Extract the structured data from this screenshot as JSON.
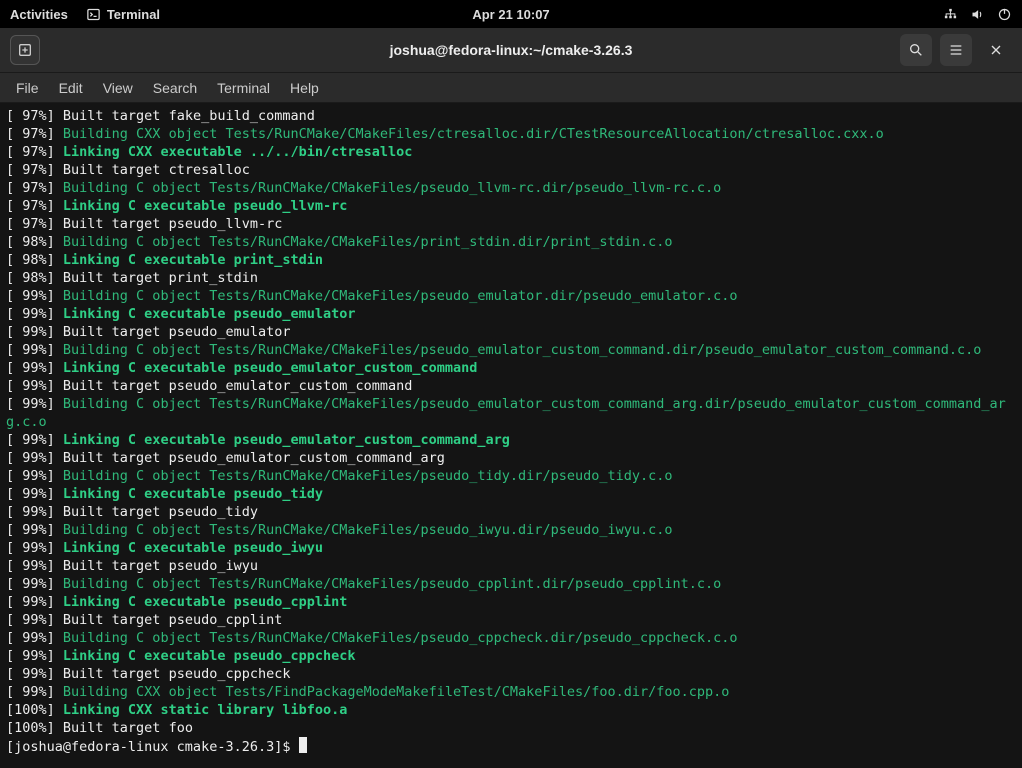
{
  "topbar": {
    "activities": "Activities",
    "app_label": "Terminal",
    "datetime": "Apr 21  10:07"
  },
  "titlebar": {
    "title": "joshua@fedora-linux:~/cmake-3.26.3"
  },
  "menubar": {
    "items": [
      "File",
      "Edit",
      "View",
      "Search",
      "Terminal",
      "Help"
    ]
  },
  "lines": [
    {
      "pct": "97%",
      "style": "plain",
      "text": "Built target fake_build_command"
    },
    {
      "pct": "97%",
      "style": "green",
      "text": "Building CXX object Tests/RunCMake/CMakeFiles/ctresalloc.dir/CTestResourceAllocation/ctresalloc.cxx.o"
    },
    {
      "pct": "97%",
      "style": "brightgreen",
      "text": "Linking CXX executable ../../bin/ctresalloc"
    },
    {
      "pct": "97%",
      "style": "plain",
      "text": "Built target ctresalloc"
    },
    {
      "pct": "97%",
      "style": "green",
      "text": "Building C object Tests/RunCMake/CMakeFiles/pseudo_llvm-rc.dir/pseudo_llvm-rc.c.o"
    },
    {
      "pct": "97%",
      "style": "brightgreen",
      "text": "Linking C executable pseudo_llvm-rc"
    },
    {
      "pct": "97%",
      "style": "plain",
      "text": "Built target pseudo_llvm-rc"
    },
    {
      "pct": "98%",
      "style": "green",
      "text": "Building C object Tests/RunCMake/CMakeFiles/print_stdin.dir/print_stdin.c.o"
    },
    {
      "pct": "98%",
      "style": "brightgreen",
      "text": "Linking C executable print_stdin"
    },
    {
      "pct": "98%",
      "style": "plain",
      "text": "Built target print_stdin"
    },
    {
      "pct": "99%",
      "style": "green",
      "text": "Building C object Tests/RunCMake/CMakeFiles/pseudo_emulator.dir/pseudo_emulator.c.o"
    },
    {
      "pct": "99%",
      "style": "brightgreen",
      "text": "Linking C executable pseudo_emulator"
    },
    {
      "pct": "99%",
      "style": "plain",
      "text": "Built target pseudo_emulator"
    },
    {
      "pct": "99%",
      "style": "green",
      "text": "Building C object Tests/RunCMake/CMakeFiles/pseudo_emulator_custom_command.dir/pseudo_emulator_custom_command.c.o"
    },
    {
      "pct": "99%",
      "style": "brightgreen",
      "text": "Linking C executable pseudo_emulator_custom_command"
    },
    {
      "pct": "99%",
      "style": "plain",
      "text": "Built target pseudo_emulator_custom_command"
    },
    {
      "pct": "99%",
      "style": "green",
      "text": "Building C object Tests/RunCMake/CMakeFiles/pseudo_emulator_custom_command_arg.dir/pseudo_emulator_custom_command_arg.c.o"
    },
    {
      "pct": "99%",
      "style": "brightgreen",
      "text": "Linking C executable pseudo_emulator_custom_command_arg"
    },
    {
      "pct": "99%",
      "style": "plain",
      "text": "Built target pseudo_emulator_custom_command_arg"
    },
    {
      "pct": "99%",
      "style": "green",
      "text": "Building C object Tests/RunCMake/CMakeFiles/pseudo_tidy.dir/pseudo_tidy.c.o"
    },
    {
      "pct": "99%",
      "style": "brightgreen",
      "text": "Linking C executable pseudo_tidy"
    },
    {
      "pct": "99%",
      "style": "plain",
      "text": "Built target pseudo_tidy"
    },
    {
      "pct": "99%",
      "style": "green",
      "text": "Building C object Tests/RunCMake/CMakeFiles/pseudo_iwyu.dir/pseudo_iwyu.c.o"
    },
    {
      "pct": "99%",
      "style": "brightgreen",
      "text": "Linking C executable pseudo_iwyu"
    },
    {
      "pct": "99%",
      "style": "plain",
      "text": "Built target pseudo_iwyu"
    },
    {
      "pct": "99%",
      "style": "green",
      "text": "Building C object Tests/RunCMake/CMakeFiles/pseudo_cpplint.dir/pseudo_cpplint.c.o"
    },
    {
      "pct": "99%",
      "style": "brightgreen",
      "text": "Linking C executable pseudo_cpplint"
    },
    {
      "pct": "99%",
      "style": "plain",
      "text": "Built target pseudo_cpplint"
    },
    {
      "pct": "99%",
      "style": "green",
      "text": "Building C object Tests/RunCMake/CMakeFiles/pseudo_cppcheck.dir/pseudo_cppcheck.c.o"
    },
    {
      "pct": "99%",
      "style": "brightgreen",
      "text": "Linking C executable pseudo_cppcheck"
    },
    {
      "pct": "99%",
      "style": "plain",
      "text": "Built target pseudo_cppcheck"
    },
    {
      "pct": "99%",
      "style": "green",
      "text": "Building CXX object Tests/FindPackageModeMakefileTest/CMakeFiles/foo.dir/foo.cpp.o"
    },
    {
      "pct": "100%",
      "style": "brightgreen",
      "text": "Linking CXX static library libfoo.a"
    },
    {
      "pct": "100%",
      "style": "plain",
      "text": "Built target foo"
    }
  ],
  "prompt": "[joshua@fedora-linux cmake-3.26.3]$ "
}
